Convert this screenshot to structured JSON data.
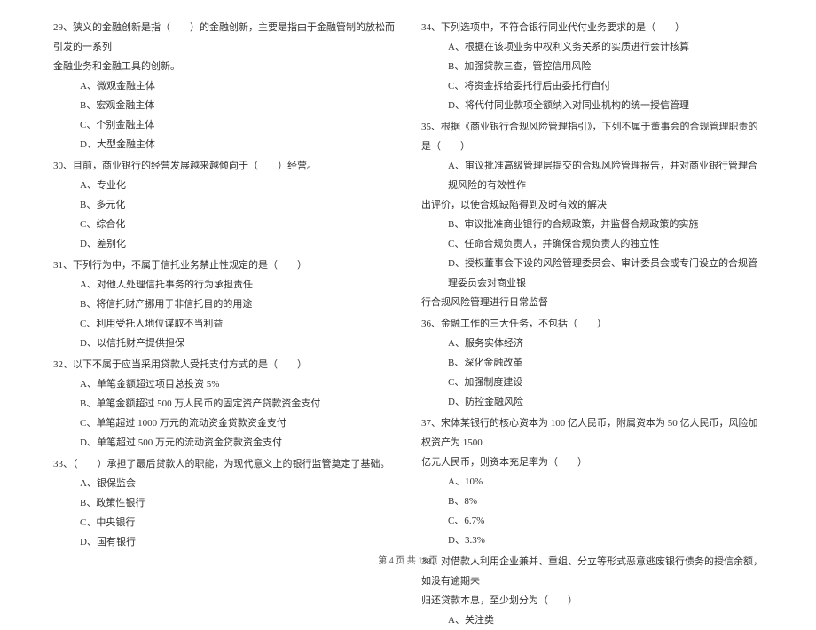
{
  "left_column": {
    "q29": {
      "stem": "29、狭义的金融创新是指（　　）的金融创新，主要是指由于金融管制的放松而引发的一系列",
      "stem2": "金融业务和金融工具的创新。",
      "options": [
        "A、微观金融主体",
        "B、宏观金融主体",
        "C、个别金融主体",
        "D、大型金融主体"
      ]
    },
    "q30": {
      "stem": "30、目前，商业银行的经营发展越来越倾向于（　　）经营。",
      "options": [
        "A、专业化",
        "B、多元化",
        "C、综合化",
        "D、差别化"
      ]
    },
    "q31": {
      "stem": "31、下列行为中，不属于信托业务禁止性规定的是（　　）",
      "options": [
        "A、对他人处理信托事务的行为承担责任",
        "B、将信托财产挪用于非信托目的的用途",
        "C、利用受托人地位谋取不当利益",
        "D、以信托财产提供担保"
      ]
    },
    "q32": {
      "stem": "32、以下不属于应当采用贷款人受托支付方式的是（　　）",
      "options": [
        "A、单笔金额超过项目总投资 5%",
        "B、单笔金额超过 500 万人民币的固定资产贷款资金支付",
        "C、单笔超过 1000 万元的流动资金贷款资金支付",
        "D、单笔超过 500 万元的流动资金贷款资金支付"
      ]
    },
    "q33": {
      "stem": "33、（　　）承担了最后贷款人的职能，为现代意义上的银行监管奠定了基础。",
      "options": [
        "A、银保监会",
        "B、政策性银行",
        "C、中央银行",
        "D、国有银行"
      ]
    }
  },
  "right_column": {
    "q34": {
      "stem": "34、下列选项中，不符合银行同业代付业务要求的是（　　）",
      "options": [
        "A、根据在该项业务中权利义务关系的实质进行会计核算",
        "B、加强贷款三查，管控信用风险",
        "C、将资金拆给委托行后由委托行自付",
        "D、将代付同业款项全额纳入对同业机构的统一授信管理"
      ]
    },
    "q35": {
      "stem": "35、根据《商业银行合规风险管理指引》，下列不属于董事会的合规管理职责的是（　　）",
      "options_prefix": [
        "A、审议批准高级管理层提交的合规风险管理报告，并对商业银行管理合规风险的有效性作"
      ],
      "continuation": "出评价，以使合规缺陷得到及时有效的解决",
      "options": [
        "B、审议批准商业银行的合规政策，并监督合规政策的实施",
        "C、任命合规负责人，并确保合规负责人的独立性",
        "D、授权董事会下设的风险管理委员会、审计委员会或专门设立的合规管理委员会对商业银"
      ],
      "continuation2": "行合规风险管理进行日常监督"
    },
    "q36": {
      "stem": "36、金融工作的三大任务，不包括（　　）",
      "options": [
        "A、服务实体经济",
        "B、深化金融改革",
        "C、加强制度建设",
        "D、防控金融风险"
      ]
    },
    "q37": {
      "stem": "37、宋体某银行的核心资本为 100 亿人民币，附属资本为 50 亿人民币，风险加权资产为 1500",
      "stem2": "亿元人民币，则资本充足率为（　　）",
      "options": [
        "A、10%",
        "B、8%",
        "C、6.7%",
        "D、3.3%"
      ]
    },
    "q38": {
      "stem": "38、对借款人利用企业兼并、重组、分立等形式恶意逃废银行债务的授信余额，如没有逾期未",
      "stem2": "归还贷款本息，至少划分为（　　）",
      "options": [
        "A、关注类"
      ]
    }
  },
  "footer": "第 4 页 共 18 页"
}
